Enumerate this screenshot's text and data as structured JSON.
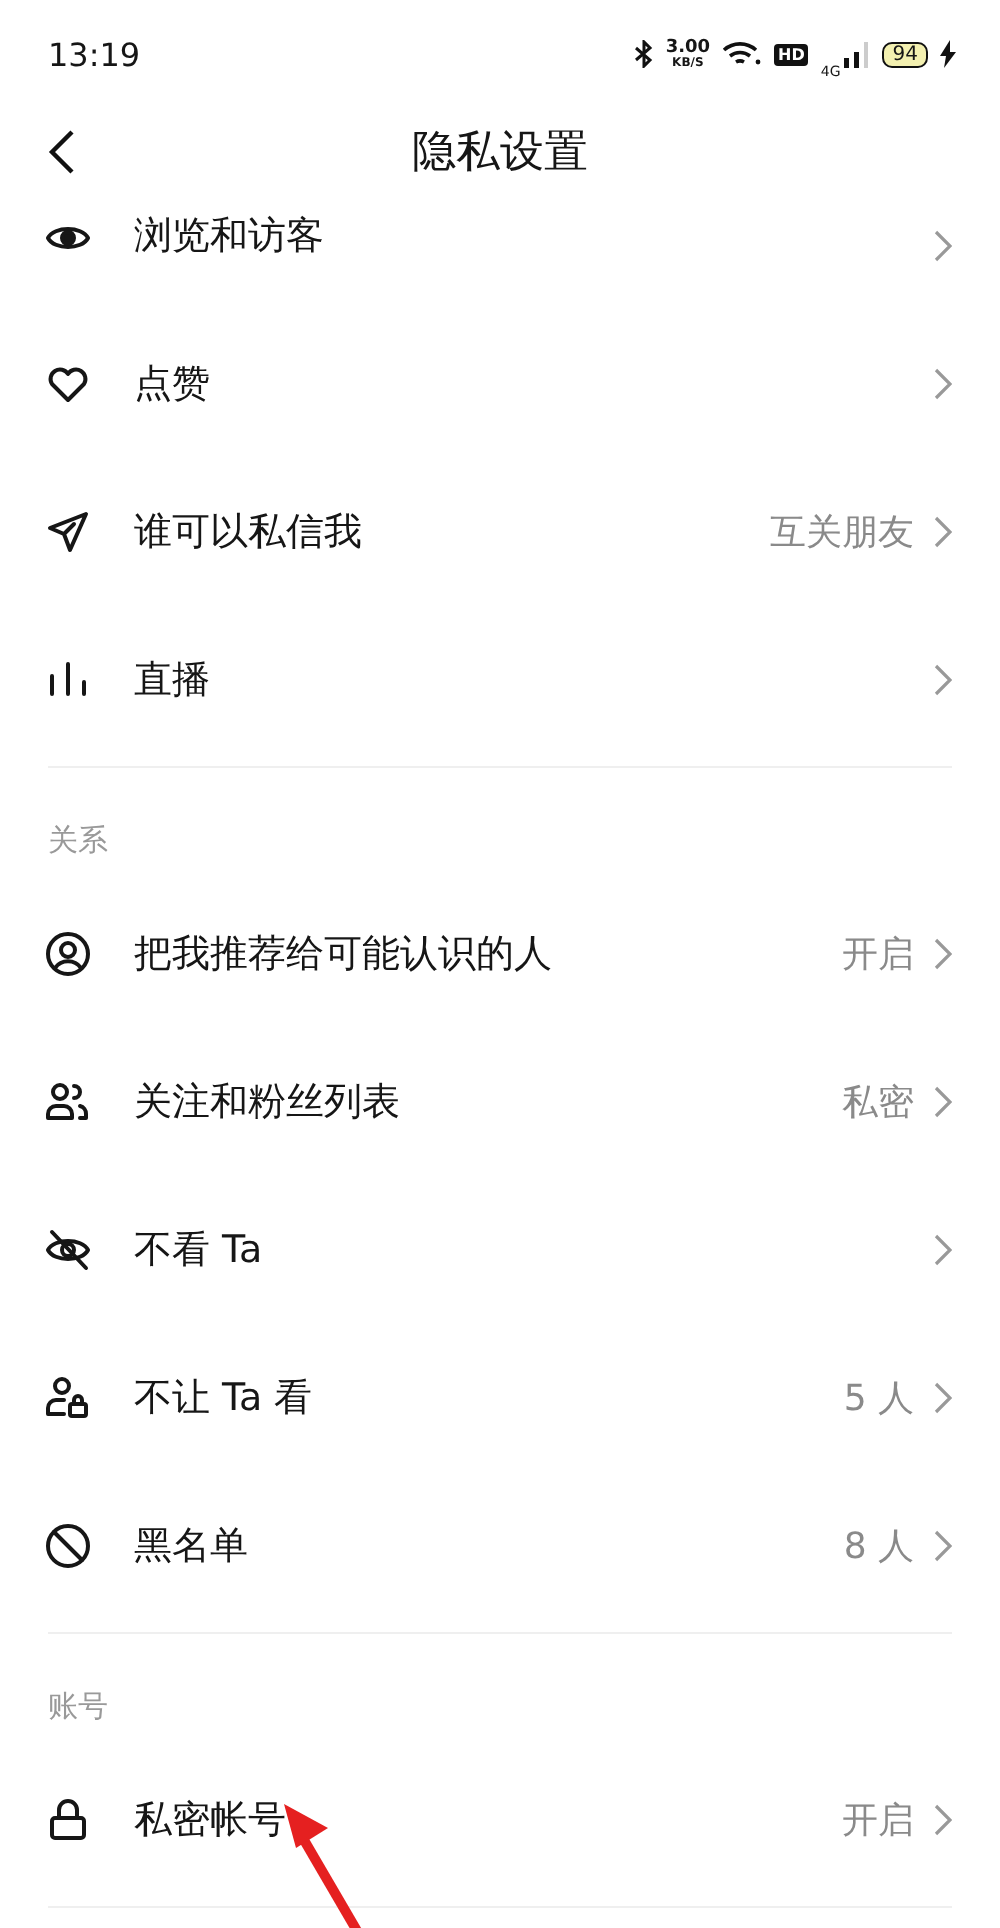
{
  "status_bar": {
    "time": "13:19",
    "speed": "3.00",
    "speed_unit": "KB/S",
    "hd": "HD",
    "network": "4G",
    "battery": "94"
  },
  "header": {
    "title": "隐私设置"
  },
  "sections": [
    {
      "items": [
        {
          "label": "浏览和访客"
        },
        {
          "label": "点赞"
        },
        {
          "label": "谁可以私信我",
          "value": "互关朋友"
        },
        {
          "label": "直播"
        }
      ]
    },
    {
      "title": "关系",
      "items": [
        {
          "label": "把我推荐给可能认识的人",
          "value": "开启"
        },
        {
          "label": "关注和粉丝列表",
          "value": "私密"
        },
        {
          "label": "不看 Ta"
        },
        {
          "label": "不让 Ta 看",
          "value": "5 人"
        },
        {
          "label": "黑名单",
          "value": "8 人"
        }
      ]
    },
    {
      "title": "账号",
      "items": [
        {
          "label": "私密帐号",
          "value": "开启"
        }
      ]
    }
  ]
}
